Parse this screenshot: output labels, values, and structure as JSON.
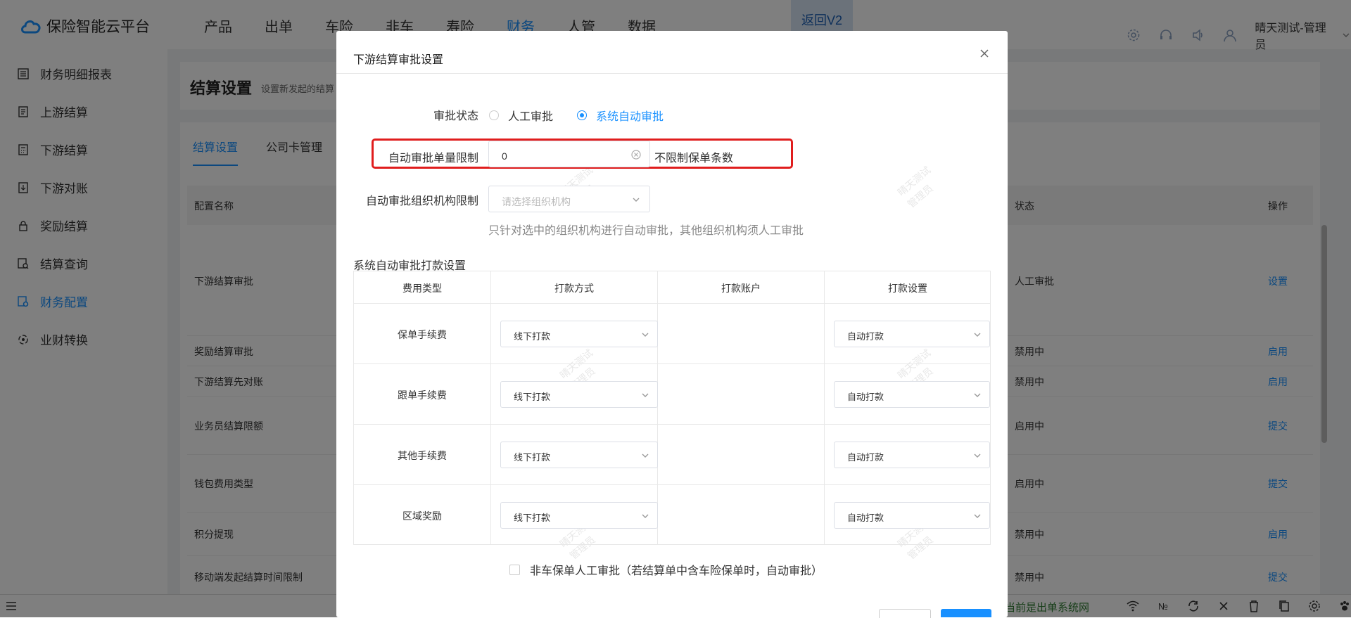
{
  "app": {
    "title": "保险智能云平台"
  },
  "nav": [
    "产品",
    "出单",
    "车险",
    "非车",
    "寿险",
    "财务",
    "人管",
    "数据"
  ],
  "nav_active_index": 5,
  "back_v2": "返回V2",
  "user": {
    "name": "晴天测试-管理员"
  },
  "sidebar": [
    {
      "label": "财务明细报表",
      "icon": "report-icon"
    },
    {
      "label": "上游结算",
      "icon": "document-icon"
    },
    {
      "label": "下游结算",
      "icon": "calculator-icon"
    },
    {
      "label": "下游对账",
      "icon": "download-doc-icon"
    },
    {
      "label": "奖励结算",
      "icon": "lock-icon"
    },
    {
      "label": "结算查询",
      "icon": "search-doc-icon"
    },
    {
      "label": "财务配置",
      "icon": "settings-doc-icon"
    },
    {
      "label": "业财转换",
      "icon": "convert-icon"
    }
  ],
  "sidebar_active_index": 6,
  "page": {
    "title": "结算设置",
    "desc": "设置新发起的结算"
  },
  "tabs": [
    "结算设置",
    "公司卡管理"
  ],
  "table": {
    "headers": [
      "配置名称",
      "状态",
      "操作"
    ],
    "rows": [
      {
        "name": "下游结算审批",
        "status": "人工审批",
        "action": "设置"
      },
      {
        "name": "奖励结算审批",
        "status": "禁用中",
        "action": "启用"
      },
      {
        "name": "下游结算先对账",
        "status": "禁用中",
        "action": "启用"
      },
      {
        "name": "业务员结算限额",
        "status": "启用中",
        "action": "提交"
      },
      {
        "name": "钱包费用类型",
        "status": "启用中",
        "action": "提交"
      },
      {
        "name": "积分提现",
        "status": "禁用中",
        "action": "启用"
      },
      {
        "name": "移动端发起结算时间限制",
        "status": "禁用中",
        "action": "提交"
      }
    ]
  },
  "bottombar": {
    "status": "当前是出单系统网",
    "no_label": "№"
  },
  "modal": {
    "title": "下游结算审批设置",
    "approval_status_label": "审批状态",
    "radio_options": [
      "人工审批",
      "系统自动审批"
    ],
    "radio_selected_index": 1,
    "limit_label": "自动审批单量限制",
    "limit_value": "0",
    "limit_hint": "不限制保单条数",
    "org_label": "自动审批组织机构限制",
    "org_placeholder": "请选择组织机构",
    "org_hint": "只针对选中的组织机构进行自动审批，其他组织机构须人工审批",
    "payment_section": "系统自动审批打款设置",
    "payment_headers": [
      "费用类型",
      "打款方式",
      "打款账户",
      "打款设置"
    ],
    "payment_rows": [
      {
        "fee": "保单手续费",
        "method": "线下打款",
        "setting": "自动打款"
      },
      {
        "fee": "跟单手续费",
        "method": "线下打款",
        "setting": "自动打款"
      },
      {
        "fee": "其他手续费",
        "method": "线下打款",
        "setting": "自动打款"
      },
      {
        "fee": "区域奖励",
        "method": "线下打款",
        "setting": "自动打款"
      }
    ],
    "nonauto_checkbox": "非车保单人工审批（若结算单中含车险保单时，自动审批）"
  },
  "watermark": {
    "line1": "晴天测试",
    "line2": "管理员"
  },
  "colors": {
    "primary": "#1890ff",
    "highlight": "#e01d1d"
  }
}
